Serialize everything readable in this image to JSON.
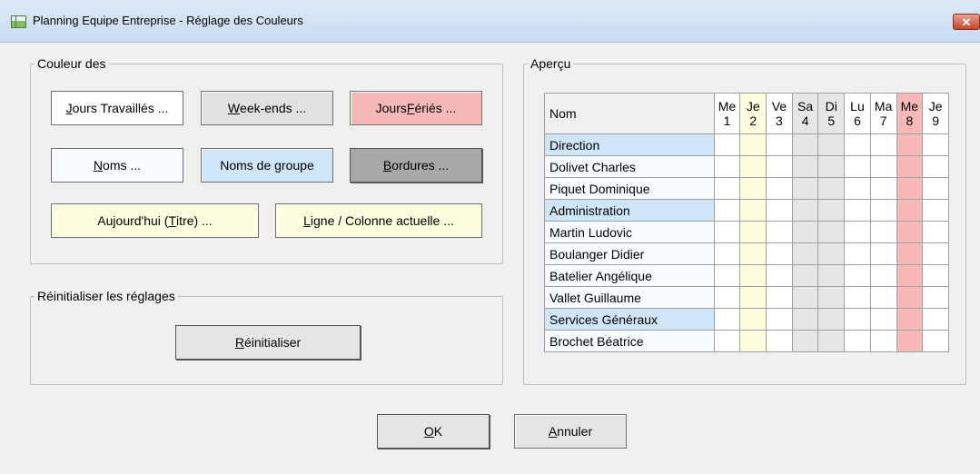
{
  "window": {
    "title": "Planning Equipe Entreprise - Réglage des Couleurs",
    "close_symbol": "✕",
    "icon": "planning-app-icon"
  },
  "colors_group": {
    "legend": "Couleur des",
    "buttons": {
      "jours_travailles": {
        "pre": "",
        "u": "J",
        "post": "ours Travaillés ...",
        "bg": "#ffffff"
      },
      "week_ends": {
        "pre": "",
        "u": "W",
        "post": "eek-ends ...",
        "bg": "#e1e1e1"
      },
      "jours_feries": {
        "pre": "Jours ",
        "u": "F",
        "post": "ériés ...",
        "bg": "#f7b8b8"
      },
      "noms": {
        "pre": "",
        "u": "N",
        "post": "oms ...",
        "bg": "#f8fbff"
      },
      "noms_groupe": {
        "pre": "Noms de groupe",
        "u": "",
        "post": "",
        "bg": "#cfe5f8"
      },
      "bordures": {
        "pre": "",
        "u": "B",
        "post": "ordures ...",
        "bg": "#a8a8a8"
      },
      "aujourdhui": {
        "pre": "Aujourd'hui (",
        "u": "T",
        "post": "itre) ...",
        "bg": "#fffde0"
      },
      "ligne_colonne": {
        "pre": "",
        "u": "L",
        "post": "igne / Colonne actuelle ...",
        "bg": "#fffde0"
      }
    }
  },
  "reset_group": {
    "legend": "Réinitialiser les réglages",
    "button": {
      "pre": "",
      "u": "R",
      "post": "éinitialiser"
    }
  },
  "preview": {
    "legend": "Aperçu",
    "header_name": "Nom",
    "days": [
      {
        "d": "Me",
        "n": "1",
        "type": "normal"
      },
      {
        "d": "Je",
        "n": "2",
        "type": "today"
      },
      {
        "d": "Ve",
        "n": "3",
        "type": "normal"
      },
      {
        "d": "Sa",
        "n": "4",
        "type": "weekend"
      },
      {
        "d": "Di",
        "n": "5",
        "type": "weekend"
      },
      {
        "d": "Lu",
        "n": "6",
        "type": "normal"
      },
      {
        "d": "Ma",
        "n": "7",
        "type": "normal"
      },
      {
        "d": "Me",
        "n": "8",
        "type": "holiday"
      },
      {
        "d": "Je",
        "n": "9",
        "type": "normal"
      }
    ],
    "rows": [
      {
        "name": "Direction",
        "group": true
      },
      {
        "name": "Dolivet Charles",
        "group": false
      },
      {
        "name": "Piquet Dominique",
        "group": false
      },
      {
        "name": "Administration",
        "group": true
      },
      {
        "name": "Martin Ludovic",
        "group": false
      },
      {
        "name": "Boulanger Didier",
        "group": false
      },
      {
        "name": "Batelier Angélique",
        "group": false
      },
      {
        "name": "Vallet Guillaume",
        "group": false
      },
      {
        "name": "Services Généraux",
        "group": true
      },
      {
        "name": "Brochet Béatrice",
        "group": false
      }
    ],
    "palette": {
      "normal": "#ffffff",
      "today": "#fffde0",
      "weekend": "#e6e6e6",
      "holiday": "#f7b8b8",
      "group": "#cfe5f8",
      "name": "#f8fbff"
    }
  },
  "footer": {
    "ok": {
      "pre": "",
      "u": "O",
      "post": "K"
    },
    "cancel": {
      "pre": "",
      "u": "A",
      "post": "nnuler"
    }
  }
}
